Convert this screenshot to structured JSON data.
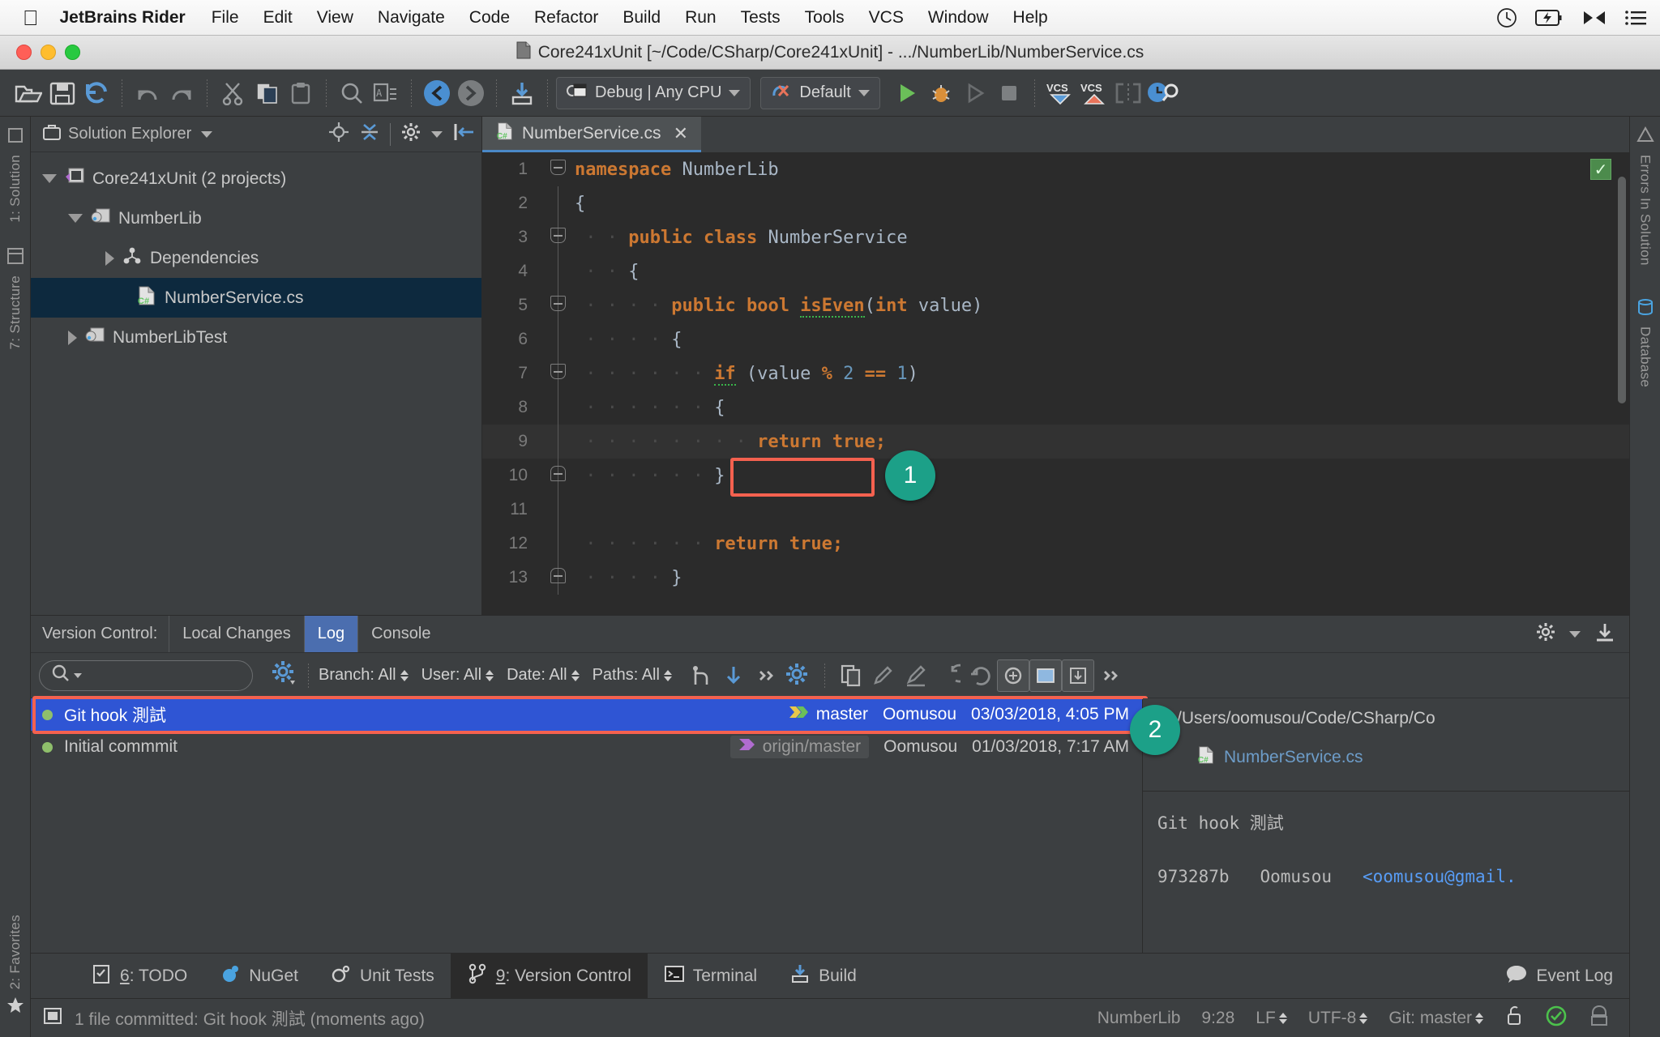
{
  "macmenu": {
    "apple_icon": "apple-logo-icon",
    "app_name": "JetBrains Rider",
    "items": [
      "File",
      "Edit",
      "View",
      "Navigate",
      "Code",
      "Refactor",
      "Build",
      "Run",
      "Tests",
      "Tools",
      "VCS",
      "Window",
      "Help"
    ],
    "status_icons": [
      "clock-icon",
      "battery-charging-icon",
      "bluetooth-icon",
      "list-menu-icon"
    ]
  },
  "window": {
    "title": "Core241xUnit [~/Code/CSharp/Core241xUnit] - .../NumberLib/NumberService.cs",
    "title_icon": "document-icon"
  },
  "toolbar": {
    "icons": [
      "open-folder-icon",
      "save-icon",
      "sync-icon",
      "undo-icon",
      "redo-icon",
      "cut-icon",
      "copy-icon",
      "paste-icon",
      "find-icon",
      "replace-icon",
      "back-icon",
      "forward-icon",
      "build-icon"
    ],
    "config_combo": {
      "label": "Debug | Any CPU",
      "icon": "configuration-icon"
    },
    "runconfig_combo": {
      "label": "Default",
      "icon": "run-config-icon"
    },
    "run_icon": "run-green-triangle-icon",
    "debug_icon": "debug-bug-icon",
    "run_coverage_icon": "run-with-coverage-icon",
    "stop_icon": "stop-square-icon",
    "vcs_update_icon": "vcs-update-icon",
    "vcs_commit_icon": "vcs-commit-icon",
    "vcs_diff_icon": "vcs-compare-icon",
    "vcs_history_icon": "vcs-history-search-icon"
  },
  "left_rail": [
    "1: Solution",
    "7: Structure",
    "2: Favorites"
  ],
  "right_rail": [
    "Errors In Solution",
    "Database"
  ],
  "solution_explorer": {
    "header": "Solution Explorer",
    "header_icon": "briefcase-icon",
    "tools": [
      "locate-target-icon",
      "collapse-all-icon",
      "settings-gear-icon",
      "hide-panel-icon"
    ],
    "tree": [
      {
        "label": "Core241xUnit (2 projects)",
        "icon": "solution-icon",
        "indent": 0,
        "state": "expanded",
        "selected": false
      },
      {
        "label": "NumberLib",
        "icon": "project-icon",
        "indent": 1,
        "state": "expanded",
        "selected": false
      },
      {
        "label": "Dependencies",
        "icon": "dependencies-icon",
        "indent": 2,
        "state": "collapsed",
        "selected": false
      },
      {
        "label": "NumberService.cs",
        "icon": "csharp-file-icon",
        "indent": 3,
        "state": "leaf",
        "selected": true
      },
      {
        "label": "NumberLibTest",
        "icon": "project-icon",
        "indent": 1,
        "state": "collapsed",
        "selected": false
      }
    ]
  },
  "editor": {
    "tab": {
      "label": "NumberService.cs",
      "icon": "csharp-file-icon",
      "close": "✕"
    },
    "inspection_ok": "✓",
    "lines": [
      {
        "n": "1",
        "fold": "minus",
        "indent": 0,
        "tokens": [
          {
            "t": "namespace",
            "c": "kw"
          },
          {
            "t": " ",
            "c": "dot"
          },
          {
            "t": "NumberLib",
            "c": "typ"
          }
        ]
      },
      {
        "n": "2",
        "fold": "none",
        "indent": 0,
        "tokens": [
          {
            "t": "{",
            "c": "typ"
          }
        ]
      },
      {
        "n": "3",
        "fold": "minus",
        "indent": 1,
        "tokens": [
          {
            "t": "public",
            "c": "kw"
          },
          {
            "t": " ",
            "c": "dot"
          },
          {
            "t": "class",
            "c": "kw"
          },
          {
            "t": " ",
            "c": "dot"
          },
          {
            "t": "NumberService",
            "c": "typ"
          }
        ]
      },
      {
        "n": "4",
        "fold": "none",
        "indent": 1,
        "tokens": [
          {
            "t": "{",
            "c": "typ"
          }
        ]
      },
      {
        "n": "5",
        "fold": "minus",
        "indent": 2,
        "tokens": [
          {
            "t": "public",
            "c": "kw"
          },
          {
            "t": " ",
            "c": "dot"
          },
          {
            "t": "bool",
            "c": "kw"
          },
          {
            "t": " ",
            "c": "dot"
          },
          {
            "t": "isEven",
            "c": "warnu"
          },
          {
            "t": "(",
            "c": "typ"
          },
          {
            "t": "int",
            "c": "kw"
          },
          {
            "t": " value)",
            "c": "typ"
          }
        ]
      },
      {
        "n": "6",
        "fold": "none",
        "indent": 2,
        "tokens": [
          {
            "t": "{",
            "c": "typ"
          }
        ]
      },
      {
        "n": "7",
        "fold": "minus",
        "indent": 3,
        "tokens": [
          {
            "t": "if",
            "c": "warnkw"
          },
          {
            "t": " (value ",
            "c": "typ"
          },
          {
            "t": "%",
            "c": "kw"
          },
          {
            "t": " ",
            "c": "typ"
          },
          {
            "t": "2",
            "c": "num"
          },
          {
            "t": " ",
            "c": "typ"
          },
          {
            "t": "==",
            "c": "kw"
          },
          {
            "t": " ",
            "c": "typ"
          },
          {
            "t": "1",
            "c": "num"
          },
          {
            "t": ")",
            "c": "typ"
          }
        ]
      },
      {
        "n": "8",
        "fold": "none",
        "indent": 3,
        "tokens": [
          {
            "t": "{",
            "c": "typ"
          }
        ]
      },
      {
        "n": "9",
        "fold": "none",
        "indent": 4,
        "tokens": [
          {
            "t": "return",
            "c": "kw"
          },
          {
            "t": " ",
            "c": "dot"
          },
          {
            "t": "true;",
            "c": "kw"
          }
        ]
      },
      {
        "n": "10",
        "fold": "end",
        "indent": 3,
        "tokens": [
          {
            "t": "}",
            "c": "typ"
          }
        ]
      },
      {
        "n": "11",
        "fold": "none",
        "indent": 3,
        "tokens": []
      },
      {
        "n": "12",
        "fold": "none",
        "indent": 3,
        "tokens": [
          {
            "t": "return",
            "c": "kw"
          },
          {
            "t": " ",
            "c": "dot"
          },
          {
            "t": "true;",
            "c": "kw"
          }
        ]
      },
      {
        "n": "13",
        "fold": "end",
        "indent": 2,
        "tokens": [
          {
            "t": "}",
            "c": "typ"
          }
        ]
      }
    ]
  },
  "annotations": {
    "badge1": "1",
    "badge2": "2",
    "highlight_color": "#f4614f",
    "badge_color": "#1ca088"
  },
  "version_control": {
    "panel_label": "Version Control:",
    "tabs": [
      {
        "label": "Local Changes",
        "active": false
      },
      {
        "label": "Log",
        "active": true
      },
      {
        "label": "Console",
        "active": false
      }
    ],
    "panel_icons": [
      "settings-gear-icon",
      "hide-panel-down-icon"
    ],
    "log_toolbar": {
      "search_placeholder": "",
      "search_icon": "magnifier-icon",
      "gear_icon": "settings-gear-icon",
      "filters": [
        {
          "label": "Branch: All"
        },
        {
          "label": "User: All"
        },
        {
          "label": "Date: All"
        },
        {
          "label": "Paths: All"
        }
      ],
      "icons": [
        "collapse-graph-icon",
        "go-to-bottom-icon",
        "more-chevrons-icon",
        "settings-gear-blue-icon"
      ],
      "right_icons": [
        "copy-revision-icon",
        "edit-icon",
        "highlight-icon",
        "revert-icon",
        "reset-icon",
        "cherry-pick-icon",
        "show-diff-icon",
        "show-details-icon",
        "more-chevrons-icon"
      ]
    },
    "commits": [
      {
        "message": "Git hook 測試",
        "refs": [
          {
            "name": "master",
            "style": "local"
          }
        ],
        "author": "Oomusou",
        "date": "03/03/2018, 4:05 PM",
        "selected": true
      },
      {
        "message": "Initial commmit",
        "refs": [
          {
            "name": "origin/master",
            "style": "remote"
          }
        ],
        "author": "Oomusou",
        "date": "01/03/2018, 7:17 AM",
        "selected": false
      }
    ],
    "detail": {
      "path": "/Users/oomusou/Code/CSharp/Co",
      "file": "NumberService.cs",
      "file_icon": "csharp-file-icon",
      "message": "Git hook 測試",
      "hash": "973287b",
      "author": "Oomusou",
      "email": "<oomusou@gmail."
    }
  },
  "tool_windows": [
    {
      "num": "6",
      "label": ": TODO",
      "icon": "todo-icon",
      "active": false
    },
    {
      "num": "",
      "label": "NuGet",
      "icon": "nuget-icon",
      "active": false
    },
    {
      "num": "",
      "label": "Unit Tests",
      "icon": "unit-tests-icon",
      "active": false
    },
    {
      "num": "9",
      "label": ": Version Control",
      "icon": "vcs-branch-icon",
      "active": true
    },
    {
      "num": "",
      "label": "Terminal",
      "icon": "terminal-icon",
      "active": false
    },
    {
      "num": "",
      "label": "Build",
      "icon": "build-icon",
      "active": false
    }
  ],
  "event_log": {
    "label": "Event Log",
    "icon": "speech-bubble-icon"
  },
  "status_bar": {
    "icon": "film-strip-icon",
    "message": "1 file committed: Git hook 測試 (moments ago)",
    "project": "NumberLib",
    "caret": "9:28",
    "line_sep": "LF",
    "encoding": "UTF‑8",
    "branch": "Git: master",
    "icons": [
      "lock-icon",
      "inspection-ok-icon",
      "hector-icon"
    ]
  }
}
